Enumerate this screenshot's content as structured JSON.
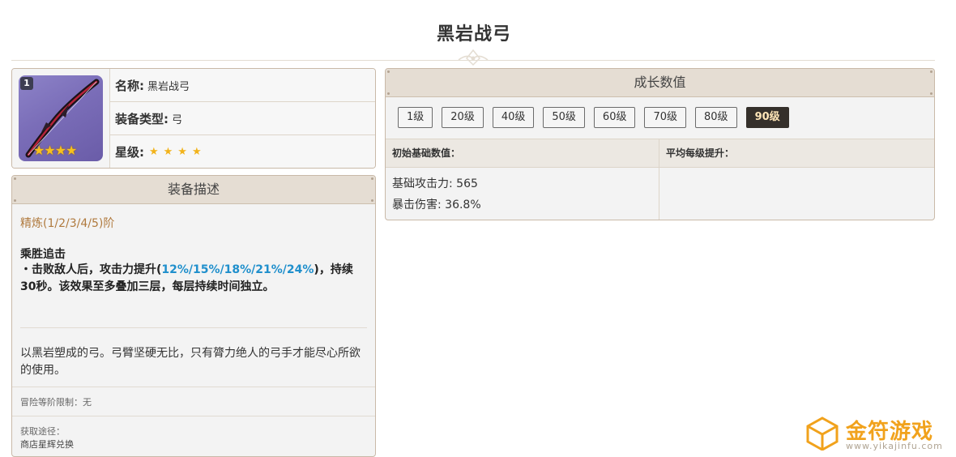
{
  "title": "黑岩战弓",
  "info": {
    "badge": "1",
    "name_key": "名称:",
    "name_val": "黑岩战弓",
    "type_key": "装备类型:",
    "type_val": "弓",
    "stars_key": "星级:",
    "stars_val": "★★★★",
    "rating": 4,
    "thumb_stars": "★★★★"
  },
  "description": {
    "header": "装备描述",
    "refine": "精炼(1/2/3/4/5)阶",
    "skill_name": "乘胜追击",
    "skill_desc_a": "・击败敌人后，攻击力提升(",
    "skill_desc_values": "12%/15%/18%/21%/24%",
    "skill_desc_b": ")，持续30秒。该效果至多叠加三层，每层持续时间独立。",
    "lore": "以黑岩塑成的弓。弓臂坚硬无比，只有膂力绝人的弓手才能尽心所欲的使用。",
    "requirement": "冒险等阶限制：无",
    "source_label": "获取途径：",
    "source_value": "商店星辉兑换"
  },
  "growth": {
    "header": "成长数值",
    "levels": [
      "1级",
      "20级",
      "40级",
      "50级",
      "60级",
      "70级",
      "80级",
      "90级"
    ],
    "active_level": "90级",
    "base_label": "初始基础数值：",
    "avg_label": "平均每级提升：",
    "stats": [
      "基础攻击力: 565",
      "暴击伤害: 36.8%"
    ]
  },
  "watermark": {
    "name": "金符游戏",
    "url": "www.yikajinfu.com"
  },
  "colors": {
    "accent_orange": "#f1a21c",
    "highlight_blue": "#1f8fcc",
    "refine_brown": "#b07a3e",
    "star_gold": "#f2b31b",
    "active_level_bg": "#35302b"
  }
}
